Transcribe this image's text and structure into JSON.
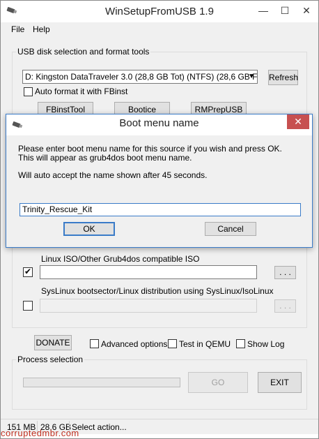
{
  "window": {
    "title": "WinSetupFromUSB 1.9",
    "minimize_glyph": "—",
    "maximize_glyph": "☐",
    "close_glyph": "✕"
  },
  "menu": {
    "file": "File",
    "help": "Help"
  },
  "usb_section": {
    "group_label": "USB disk selection and format tools",
    "disk_selected": "D: Kingston DataTraveler 3.0 (28,8 GB Tot) (NTFS) (28,6 GB Free)",
    "refresh_label": "Refresh",
    "auto_format_label": "Auto format it with FBinst",
    "auto_format_checked": false,
    "fbinst_tool_label": "FBinstTool",
    "bootice_label": "Bootice",
    "rmprepusb_label": "RMPrepUSB"
  },
  "sources": {
    "linux_iso_label": "Linux ISO/Other Grub4dos compatible ISO",
    "linux_iso_checked": true,
    "linux_iso_value": "",
    "linux_iso_browse": ". . .",
    "syslinux_label": "SysLinux bootsector/Linux distribution using SysLinux/IsoLinux",
    "syslinux_checked": false,
    "syslinux_value": "",
    "syslinux_browse": ". . ."
  },
  "bottom": {
    "donate_label": "DONATE",
    "advanced_options_label": "Advanced options",
    "advanced_options_checked": false,
    "test_qemu_label": "Test in QEMU",
    "test_qemu_checked": false,
    "show_log_label": "Show Log",
    "show_log_checked": false,
    "process_selection_label": "Process selection",
    "progress_fraction": 0,
    "go_label": "GO",
    "exit_label": "EXIT"
  },
  "status": {
    "size_1": "151 MB",
    "size_2": "28,6 GB",
    "message": "Select action..."
  },
  "dialog": {
    "title": "Boot menu name",
    "close_glyph": "✕",
    "line1": "Please enter boot menu name for this source if you wish and press OK.",
    "line2": "This will appear as grub4dos boot menu name.",
    "line3": "Will auto accept the name shown after 45 seconds.",
    "input_value": "Trinity_Rescue_Kit",
    "ok_label": "OK",
    "cancel_label": "Cancel"
  },
  "watermark": "corruptedmbr.com"
}
